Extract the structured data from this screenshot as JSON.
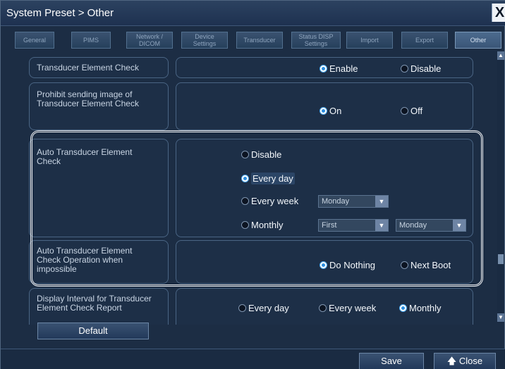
{
  "window": {
    "title": "System Preset > Other",
    "close_label": "X"
  },
  "tabs": [
    {
      "label": "General"
    },
    {
      "label": "PIMS"
    },
    {
      "label": "Network / DICOM"
    },
    {
      "label": "Device Settings"
    },
    {
      "label": "Transducer"
    },
    {
      "label": "Status DISP Settings"
    },
    {
      "label": "Import"
    },
    {
      "label": "Export"
    },
    {
      "label": "Other",
      "active": true
    }
  ],
  "settings": {
    "element_check": {
      "label": "Transducer Element Check",
      "options": [
        "Enable",
        "Disable"
      ],
      "selected": "Enable"
    },
    "prohibit_sending": {
      "label": "Prohibit sending image of Transducer Element Check",
      "options": [
        "On",
        "Off"
      ],
      "selected": "On"
    },
    "auto_check": {
      "label": "Auto Transducer Element Check",
      "options": [
        "Disable",
        "Every day",
        "Every week",
        "Monthly"
      ],
      "selected": "Every day",
      "weekly_day": "Monday",
      "monthly_week": "First",
      "monthly_day": "Monday"
    },
    "impossible_op": {
      "label": "Auto Transducer Element Check Operation when impossible",
      "options": [
        "Do Nothing",
        "Next Boot"
      ],
      "selected": "Do Nothing"
    },
    "display_interval": {
      "label": "Display Interval for Transducer Element Check Report",
      "options": [
        "Every day",
        "Every week",
        "Monthly"
      ],
      "selected": "Monthly"
    }
  },
  "buttons": {
    "default": "Default",
    "save": "Save",
    "close": "Close"
  },
  "icons": {
    "close_arrow": "up-arrow-icon"
  },
  "colors": {
    "accent": "#2a8de0",
    "panel": "#1d2f47",
    "border": "#4a6584"
  }
}
